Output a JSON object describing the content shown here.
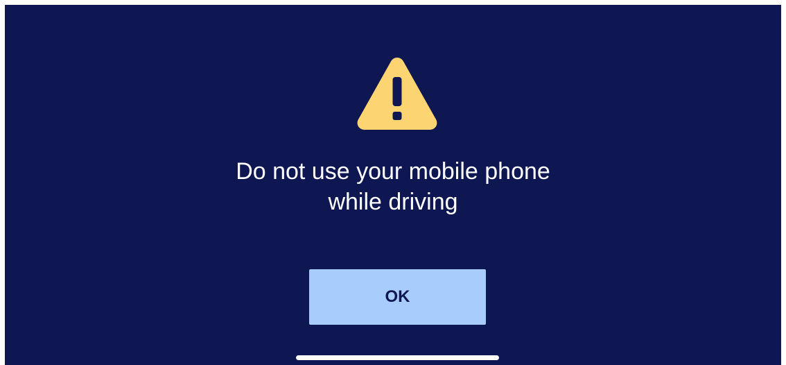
{
  "alert": {
    "message": "Do not use your mobile phone\nwhile driving",
    "icon": "warning-triangle-icon",
    "ok_label": "OK"
  },
  "colors": {
    "background": "#0e1752",
    "icon": "#fdd472",
    "button": "#a8cdfd",
    "button_text": "#0e1752",
    "text": "#ffffff"
  }
}
